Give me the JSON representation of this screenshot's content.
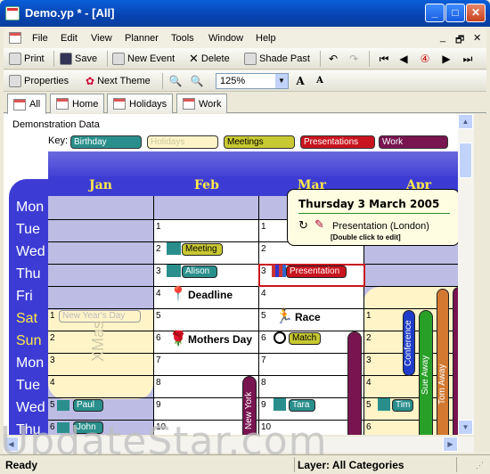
{
  "window": {
    "title": "Demo.yp * - [All]",
    "min_label": "_",
    "max_label": "□",
    "close_label": "✕"
  },
  "menu": {
    "items": [
      "File",
      "Edit",
      "View",
      "Planner",
      "Tools",
      "Window",
      "Help"
    ],
    "mdi": [
      "_",
      "🗗",
      "✕"
    ]
  },
  "toolbar1": {
    "print": "Print",
    "save": "Save",
    "new_event": "New Event",
    "delete": "Delete",
    "shade_past": "Shade Past",
    "undo": "↶",
    "redo": "↷",
    "nav_first": "⏮",
    "nav_prev": "◀",
    "nav_today": "④",
    "nav_next": "▶",
    "nav_last": "⏭"
  },
  "toolbar2": {
    "properties": "Properties",
    "next_theme": "Next Theme",
    "zoom_in": "🔍",
    "zoom_out": "🔍",
    "zoom_value": "125%",
    "font_up": "A",
    "font_down": "A"
  },
  "tabs": [
    "All",
    "Home",
    "Holidays",
    "Work"
  ],
  "planner": {
    "title": "Demonstration Data",
    "key_label": "Key:",
    "keys": [
      {
        "label": "Birthday",
        "color": "#2a8f8c"
      },
      {
        "label": "Holidays",
        "color": "#fff4c8"
      },
      {
        "label": "Meetings",
        "color": "#c8c832"
      },
      {
        "label": "Presentations",
        "color": "#c8141e"
      },
      {
        "label": "Work",
        "color": "#781450"
      }
    ],
    "months": [
      "Jan",
      "Feb",
      "Mar",
      "Apr"
    ],
    "days": [
      "Mon",
      "Tue",
      "Wed",
      "Thu",
      "Fri",
      "Sat",
      "Sun",
      "Mon",
      "Tue",
      "Wed",
      "Thu"
    ],
    "xmas": "XMas",
    "feb_nums": [
      "1",
      "2",
      "3",
      "4",
      "5",
      "6",
      "7",
      "8",
      "9",
      "10"
    ],
    "mar_nums": [
      "1",
      "2",
      "3",
      "4",
      "5",
      "6",
      "7",
      "8",
      "9",
      "10"
    ],
    "jan_nums": [
      "1",
      "2",
      "3",
      "4",
      "5",
      "6"
    ],
    "apr_nums": [
      "1",
      "2",
      "3",
      "4",
      "5",
      "6"
    ],
    "events": {
      "meeting": "Meeting",
      "alison": "Alison",
      "presentation": "Presentation",
      "deadline": "Deadline",
      "new_years": "New Year's Day",
      "race": "Race",
      "mothers_day": "Mothers Day",
      "match": "Match",
      "paul": "Paul",
      "tara": "Tara",
      "tim": "Tim",
      "john": "John",
      "new_york": "New York",
      "conference": "Conference",
      "sue_away": "Sue Away",
      "tom_away": "Tom Away"
    },
    "tooltip": {
      "date": "Thursday 3 March 2005",
      "event": "Presentation (London)",
      "hint": "[Double click to edit]"
    }
  },
  "status": {
    "ready": "Ready",
    "layer": "Layer: All Categories"
  },
  "watermark": "UpdateStar.com"
}
